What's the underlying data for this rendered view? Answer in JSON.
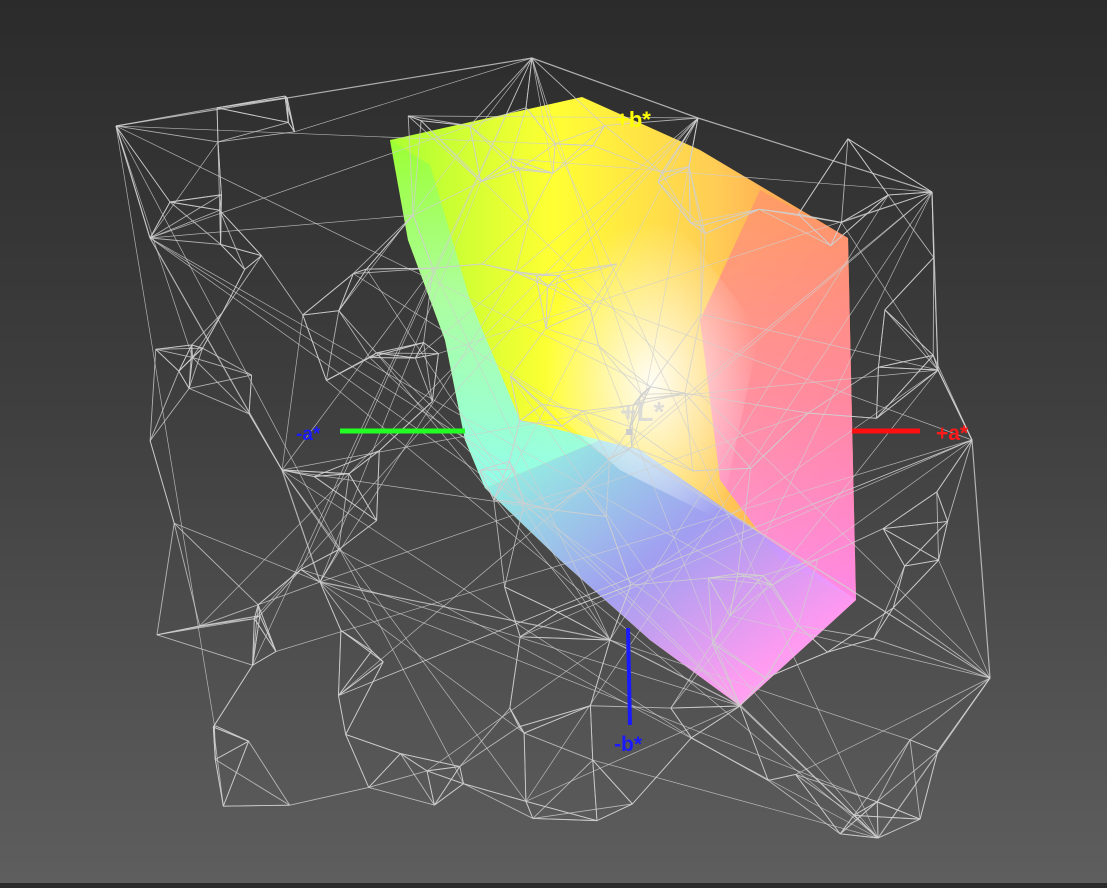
{
  "axes": {
    "pos_b": {
      "label": "+b*",
      "color": "#ffff00"
    },
    "neg_b": {
      "label": "-b*",
      "color": "#1a1aff"
    },
    "pos_a": {
      "label": "+a*",
      "color": "#ff1a1a"
    },
    "neg_a": {
      "label": "-a*",
      "color": "#1a1aff"
    },
    "pos_L": {
      "label": "+L*",
      "color": "#d8d8d8"
    }
  },
  "colors": {
    "wireframe": "#d0d0d0",
    "a_neg_axis": "#22ff22",
    "a_pos_axis": "#ff1010",
    "b_neg_axis": "#1a1aff",
    "background_top": "#2b2b2b",
    "background_bottom": "#5e5e5e"
  }
}
